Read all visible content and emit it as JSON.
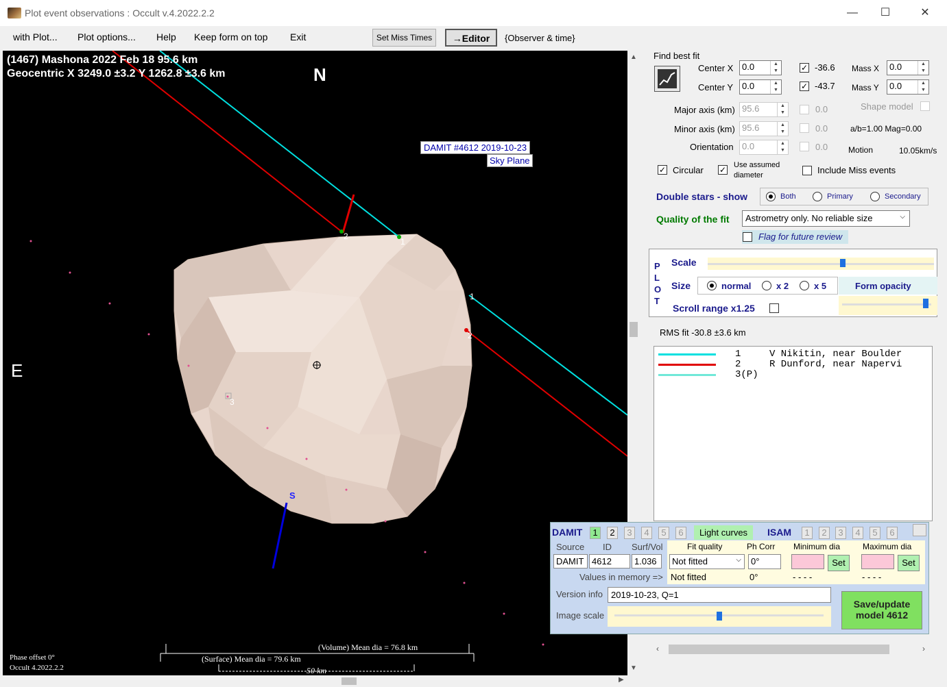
{
  "window": {
    "title": "Plot event observations : Occult v.4.2022.2.2",
    "minimize": "—",
    "maximize": "☐",
    "close": "✕"
  },
  "menu": {
    "with_plot": "with Plot...",
    "plot_options": "Plot options...",
    "help": "Help",
    "keep_on_top": "Keep form on top",
    "exit": "Exit",
    "set_miss_times": "Set Miss Times",
    "editor": "→Editor",
    "observer_time": "{Observer & time}"
  },
  "plot": {
    "header_line1": "(1467) Mashona  2022 Feb 18   95.6 km",
    "header_line2": "Geocentric  X  3249.0 ±3.2  Y  1262.8 ±3.6 km",
    "north": "N",
    "east": "E",
    "south": "S",
    "damit_label": "DAMIT #4612 2019-10-23",
    "sky_plane": "Sky Plane",
    "chord1_label": "1",
    "chord2_label": "2",
    "chord3_label": "3",
    "volume_dia": "(Volume) Mean dia = 76.8 km",
    "surface_dia": "(Surface) Mean dia = 79.6 km",
    "scale_km": "50 km",
    "phase_offset": "Phase offset 0°",
    "version": "Occult 4.2022.2.2"
  },
  "fit": {
    "section": "Find best fit",
    "center_x_label": "Center X",
    "center_x": "0.0",
    "center_y_label": "Center Y",
    "center_y": "0.0",
    "cx_result": "-36.6",
    "cy_result": "-43.7",
    "mass_x_label": "Mass X",
    "mass_x": "0.0",
    "mass_y_label": "Mass Y",
    "mass_y": "0.0",
    "major_label": "Major axis (km)",
    "major": "95.6",
    "minor_label": "Minor axis (km)",
    "minor": "95.6",
    "orient_label": "Orientation",
    "orient": "0.0",
    "major_res": "0.0",
    "minor_res": "0.0",
    "orient_res": "0.0",
    "shape_model": "Shape model",
    "ab_mag": "a/b=1.00  Mag=0.00",
    "motion_label": "Motion",
    "motion": "10.05km/s",
    "circular": "Circular",
    "assumed_diam": "Use assumed diameter",
    "include_miss": "Include Miss events"
  },
  "double": {
    "label": "Double stars - show",
    "both": "Both",
    "primary": "Primary",
    "secondary": "Secondary"
  },
  "quality": {
    "label": "Quality of the fit",
    "value": "Astrometry only. No reliable size",
    "flag": "Flag for future review"
  },
  "plotbox": {
    "letters": [
      "P",
      "L",
      "O",
      "T"
    ],
    "scale": "Scale",
    "size": "Size",
    "normal": "normal",
    "x2": "x 2",
    "x5": "x 5",
    "opacity": "Form opacity",
    "scroll": "Scroll range x1.25",
    "scale_value": 0.6,
    "opacity_value": 0.95
  },
  "rms": "RMS fit -30.8 ±3.6 km",
  "observers": [
    {
      "num": "1",
      "name": "V Nikitin, near Boulder",
      "color": "#00e0e0"
    },
    {
      "num": "2",
      "name": "R Dunford, near Napervi",
      "color": "#e00000"
    },
    {
      "num": "3(P)",
      "name": "",
      "color": "#70e8d8"
    }
  ],
  "damit": {
    "title": "DAMIT",
    "tabs": [
      "1",
      "2",
      "3",
      "4",
      "5",
      "6"
    ],
    "light_curves": "Light curves",
    "isam": "ISAM",
    "isam_tabs": [
      "1",
      "2",
      "3",
      "4",
      "5",
      "6"
    ],
    "source_label": "Source",
    "id_label": "ID",
    "surfvol_label": "Surf/Vol",
    "source": "DAMIT",
    "id": "4612",
    "surfvol": "1.036",
    "values_mem": "Values in memory =>",
    "fit_quality_label": "Fit quality",
    "ph_corr_label": "Ph Corr",
    "min_dia_label": "Minimum dia",
    "max_dia_label": "Maximum dia",
    "fit_quality": "Not fitted",
    "ph_corr": "0°",
    "fit_quality_mem": "Not fitted",
    "ph_corr_mem": "0°",
    "min_mem": "- - - -",
    "max_mem": "- - - -",
    "set": "Set",
    "version_label": "Version info",
    "version": "2019-10-23, Q=1",
    "image_scale": "Image scale",
    "image_scale_value": 0.5,
    "save": "Save/update model 4612"
  }
}
